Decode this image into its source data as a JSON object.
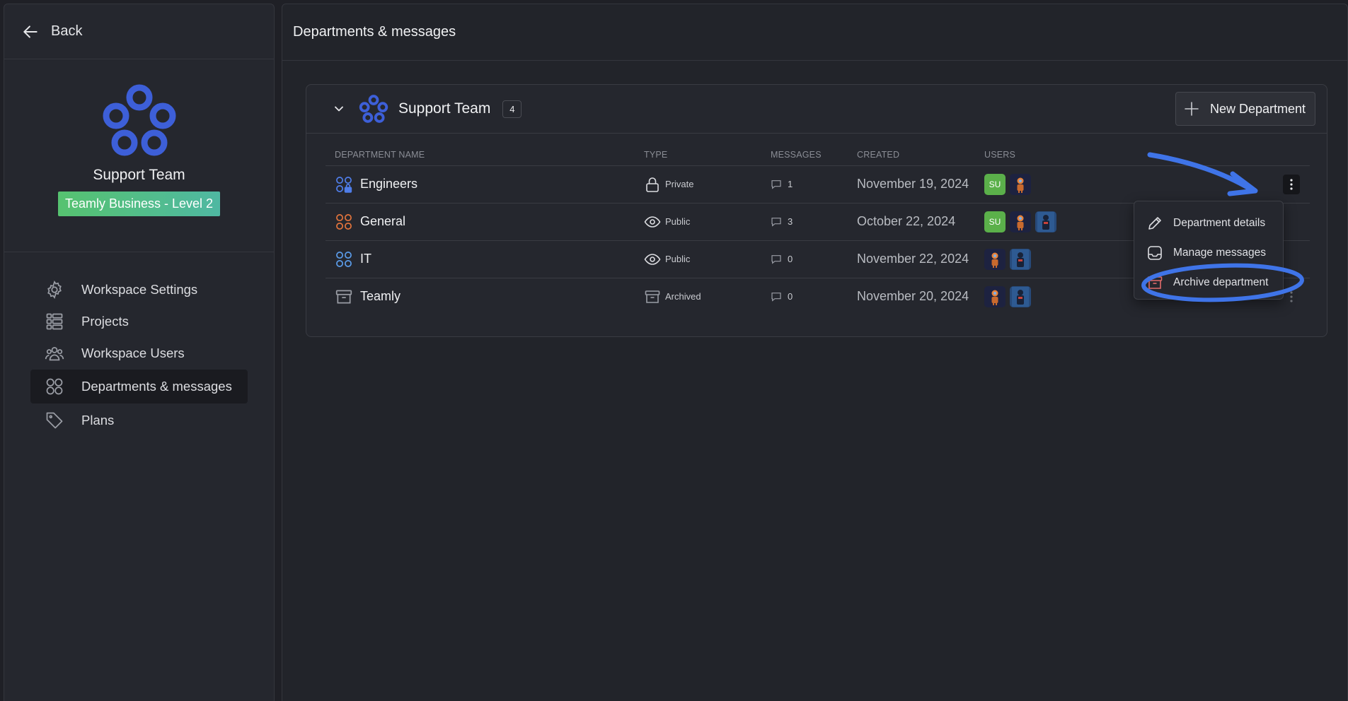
{
  "sidebar": {
    "back_label": "Back",
    "team_name": "Support Team",
    "plan_badge": "Teamly Business - Level 2",
    "nav": [
      {
        "label": "Workspace Settings",
        "icon": "gear-icon"
      },
      {
        "label": "Projects",
        "icon": "list-icon"
      },
      {
        "label": "Workspace Users",
        "icon": "users-icon"
      },
      {
        "label": "Departments & messages",
        "icon": "grid-icon",
        "active": true
      },
      {
        "label": "Plans",
        "icon": "tag-icon"
      }
    ]
  },
  "main": {
    "title": "Departments & messages",
    "team_card": {
      "title": "Support Team",
      "count": "4",
      "new_department_label": "New Department",
      "columns": [
        "DEPARTMENT NAME",
        "TYPE",
        "MESSAGES",
        "CREATED",
        "USERS"
      ],
      "rows": [
        {
          "name": "Engineers",
          "icon": "private-department-icon",
          "icon_color": "#4f7de8",
          "type": "Private",
          "type_icon": "lock-icon",
          "messages": "1",
          "created": "November 19, 2024",
          "users": [
            "SU",
            "robot-avatar"
          ]
        },
        {
          "name": "General",
          "icon": "department-icon",
          "icon_color": "#e0733c",
          "type": "Public",
          "type_icon": "eye-icon",
          "messages": "3",
          "created": "October 22, 2024",
          "users": [
            "SU",
            "robot-avatar",
            "astronaut-avatar"
          ]
        },
        {
          "name": "IT",
          "icon": "department-icon",
          "icon_color": "#5a9be8",
          "type": "Public",
          "type_icon": "eye-icon",
          "messages": "0",
          "created": "November 22, 2024",
          "users": [
            "robot-avatar",
            "astronaut-avatar"
          ]
        },
        {
          "name": "Teamly",
          "icon": "archive-icon",
          "icon_color": "#9a9da5",
          "type": "Archived",
          "type_icon": "archive-icon",
          "messages": "0",
          "created": "November 20, 2024",
          "users": [
            "robot-avatar",
            "astronaut-avatar"
          ]
        }
      ]
    }
  },
  "dropdown": {
    "items": [
      {
        "label": "Department details",
        "icon": "pencil-icon"
      },
      {
        "label": "Manage messages",
        "icon": "inbox-icon"
      },
      {
        "label": "Archive department",
        "icon": "archive-icon",
        "icon_color": "#e26b6b"
      }
    ]
  },
  "colors": {
    "accent_blue": "#3d5fd8",
    "annotation_blue": "#3f74e8",
    "su_green": "#5bb04a"
  }
}
